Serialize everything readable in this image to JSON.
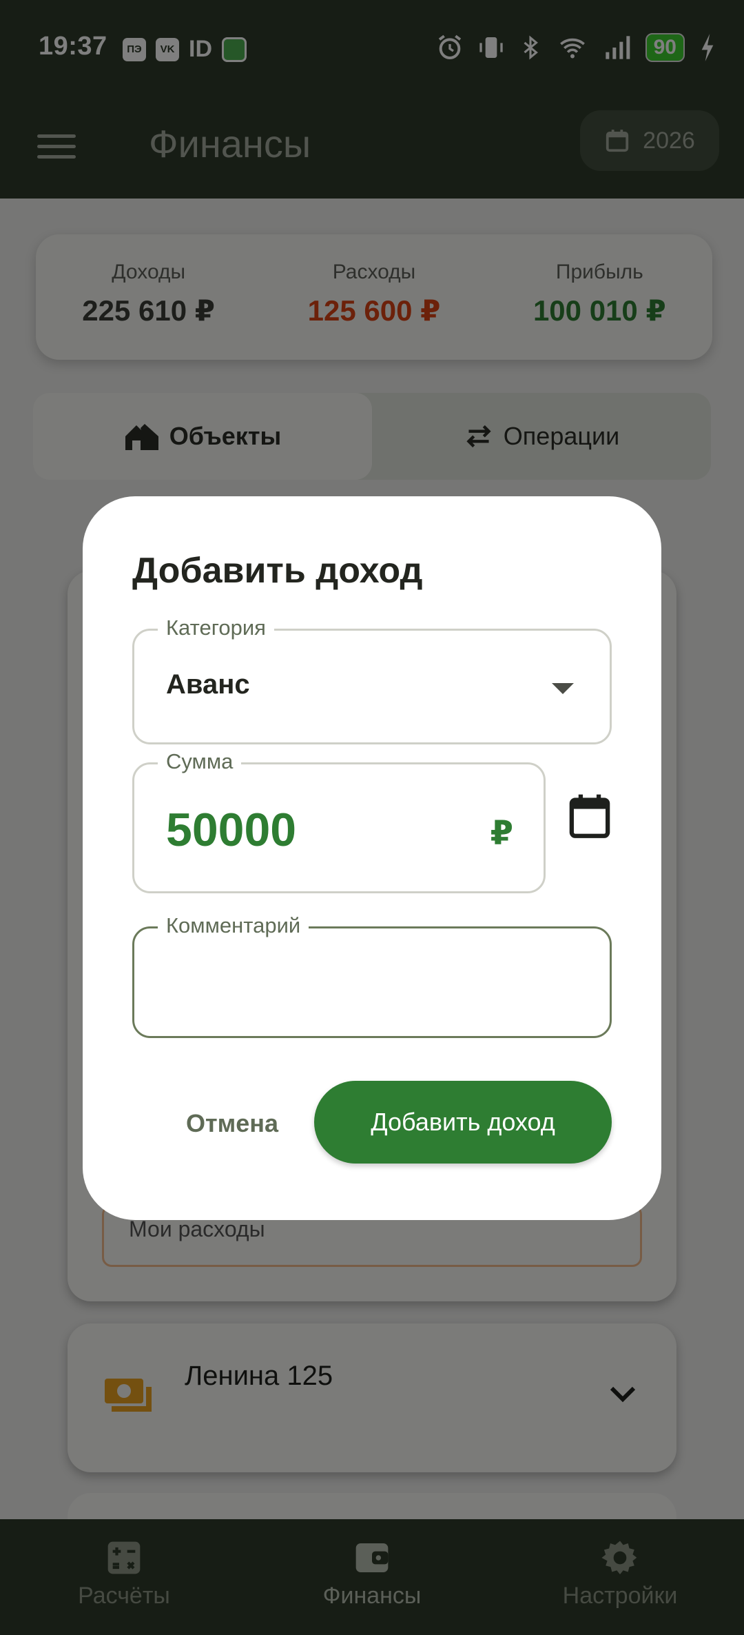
{
  "status_bar": {
    "time": "19:37",
    "chip_1": "ПЭ",
    "chip_2": "VK",
    "id_text": "ID",
    "battery": "90"
  },
  "app_bar": {
    "title": "Финансы",
    "year": "2026"
  },
  "summary": {
    "income_label": "Доходы",
    "income_value": "225 610 ₽",
    "expense_label": "Расходы",
    "expense_value": "125 600 ₽",
    "profit_label": "Прибыль",
    "profit_value": "100 010 ₽",
    "colors": {
      "income": "#3a3d37",
      "expense": "#d84315",
      "profit": "#2e7d32"
    }
  },
  "tabs": [
    {
      "label": "Объекты",
      "icon": "house-icon",
      "active": true
    },
    {
      "label": "Операции",
      "icon": "swap-arrows-icon",
      "active": false
    }
  ],
  "background_list": {
    "partial_text": "Мои расходы",
    "object_name": "Ленина 125"
  },
  "dialog": {
    "title": "Добавить доход",
    "category_label": "Категория",
    "category_value": "Аванс",
    "amount_label": "Сумма",
    "amount_value": "50000",
    "currency": "₽",
    "comment_label": "Комментарий",
    "comment_value": "",
    "cancel_label": "Отмена",
    "submit_label": "Добавить доход"
  },
  "bottom_nav": [
    {
      "label": "Расчёты",
      "icon": "calculator-icon",
      "active": false
    },
    {
      "label": "Финансы",
      "icon": "wallet-icon",
      "active": true
    },
    {
      "label": "Настройки",
      "icon": "gear-icon",
      "active": false
    }
  ],
  "theme": {
    "primary": "#2e7d32",
    "bar": "#2e3b2a",
    "accent_orange": "#d84315"
  }
}
